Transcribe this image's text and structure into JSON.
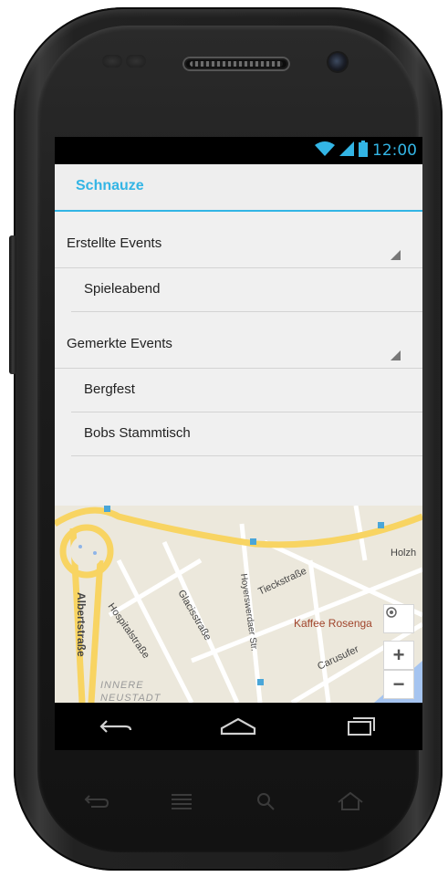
{
  "status_bar": {
    "time": "12:00"
  },
  "action_bar": {
    "title": "Schnauze"
  },
  "groups": [
    {
      "label": "Erstellte Events",
      "items": [
        "Spieleabend"
      ]
    },
    {
      "label": "Gemerkte Events",
      "items": [
        "Bergfest",
        "Bobs Stammtisch"
      ]
    }
  ],
  "map": {
    "labels": {
      "albertstrasse": "Albertstraße",
      "hospitalstrasse": "Hospitalstraße",
      "glacisstrasse": "Glacisstraße",
      "hoyerswerdaer": "Hoyerswerdaer Str.",
      "tieckstrasse": "Tieckstraße",
      "carusufer": "Carusufer",
      "holzhof": "Holzh",
      "kaffee": "Kaffee Rosenga",
      "innere": "INNERE",
      "neustadt": "NEUSTADT"
    },
    "controls": {
      "zoom_in": "+",
      "zoom_out": "−"
    }
  },
  "colors": {
    "accent": "#33b5e5",
    "map_road_major": "#f8d462",
    "map_background": "#ece8dc",
    "poi_text": "#a0442b"
  },
  "icons": [
    "wifi-icon",
    "signal-icon",
    "battery-icon",
    "my-location-icon",
    "back-icon",
    "home-icon",
    "recent-apps-icon"
  ]
}
